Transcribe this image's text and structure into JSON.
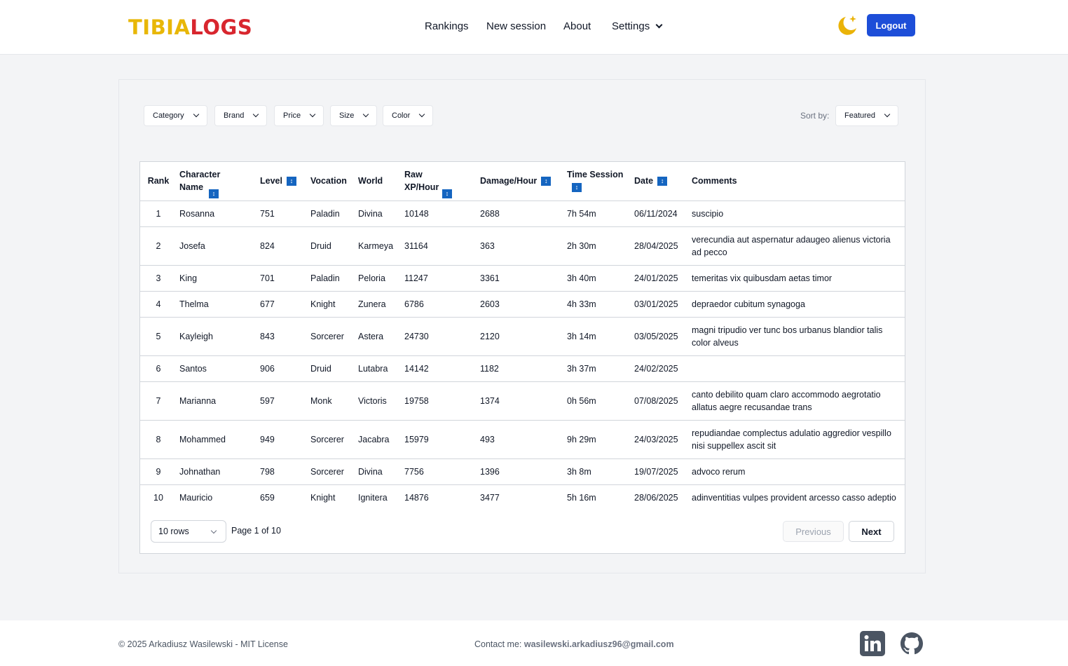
{
  "header": {
    "logo_part1": "TIBIA",
    "logo_part2": "LOGS",
    "nav": [
      "Rankings",
      "New session",
      "About",
      "Settings"
    ],
    "theme_icon": "moon-star-icon",
    "logout_label": "Logout"
  },
  "filters": [
    "Category",
    "Brand",
    "Price",
    "Size",
    "Color"
  ],
  "sort": {
    "label": "Sort by:",
    "value": "Featured"
  },
  "table": {
    "columns": [
      "Rank",
      "Character Name",
      "Level",
      "Vocation",
      "World",
      "Raw XP/Hour",
      "Damage/Hour",
      "Time Session",
      "Date",
      "Comments"
    ],
    "rows": [
      {
        "rank": "1",
        "name": "Rosanna",
        "level": "751",
        "vocation": "Paladin",
        "world": "Divina",
        "xp": "10148",
        "damage": "2688",
        "time": "7h 54m",
        "date": "06/11/2024",
        "comments": "suscipio"
      },
      {
        "rank": "2",
        "name": "Josefa",
        "level": "824",
        "vocation": "Druid",
        "world": "Karmeya",
        "xp": "31164",
        "damage": "363",
        "time": "2h 30m",
        "date": "28/04/2025",
        "comments": "verecundia aut aspernatur adaugeo alienus victoria ad pecco"
      },
      {
        "rank": "3",
        "name": "King",
        "level": "701",
        "vocation": "Paladin",
        "world": "Peloria",
        "xp": "11247",
        "damage": "3361",
        "time": "3h 40m",
        "date": "24/01/2025",
        "comments": "temeritas vix quibusdam aetas timor"
      },
      {
        "rank": "4",
        "name": "Thelma",
        "level": "677",
        "vocation": "Knight",
        "world": "Zunera",
        "xp": "6786",
        "damage": "2603",
        "time": "4h 33m",
        "date": "03/01/2025",
        "comments": "depraedor cubitum synagoga"
      },
      {
        "rank": "5",
        "name": "Kayleigh",
        "level": "843",
        "vocation": "Sorcerer",
        "world": "Astera",
        "xp": "24730",
        "damage": "2120",
        "time": "3h 14m",
        "date": "03/05/2025",
        "comments": "magni tripudio ver tunc bos urbanus blandior talis color alveus"
      },
      {
        "rank": "6",
        "name": "Santos",
        "level": "906",
        "vocation": "Druid",
        "world": "Lutabra",
        "xp": "14142",
        "damage": "1182",
        "time": "3h 37m",
        "date": "24/02/2025",
        "comments": ""
      },
      {
        "rank": "7",
        "name": "Marianna",
        "level": "597",
        "vocation": "Monk",
        "world": "Victoris",
        "xp": "19758",
        "damage": "1374",
        "time": "0h 56m",
        "date": "07/08/2025",
        "comments": "canto debilito quam claro accommodo aegrotatio allatus aegre recusandae trans"
      },
      {
        "rank": "8",
        "name": "Mohammed",
        "level": "949",
        "vocation": "Sorcerer",
        "world": "Jacabra",
        "xp": "15979",
        "damage": "493",
        "time": "9h 29m",
        "date": "24/03/2025",
        "comments": "repudiandae complectus adulatio aggredior vespillo nisi suppellex ascit sit"
      },
      {
        "rank": "9",
        "name": "Johnathan",
        "level": "798",
        "vocation": "Sorcerer",
        "world": "Divina",
        "xp": "7756",
        "damage": "1396",
        "time": "3h 8m",
        "date": "19/07/2025",
        "comments": "advoco rerum"
      },
      {
        "rank": "10",
        "name": "Mauricio",
        "level": "659",
        "vocation": "Knight",
        "world": "Ignitera",
        "xp": "14876",
        "damage": "3477",
        "time": "5h 16m",
        "date": "28/06/2025",
        "comments": "adinventitias vulpes provident arcesso casso adeptio"
      }
    ]
  },
  "pagination": {
    "rows_per_page": "10 rows",
    "page_info": "Page 1 of 10",
    "previous_label": "Previous",
    "next_label": "Next"
  },
  "footer": {
    "copyright": "© 2025 Arkadiusz Wasilewski - MIT License",
    "contact_label": "Contact me: ",
    "contact_email": "wasilewski.arkadiusz96@gmail.com",
    "icons": [
      "linkedin-icon",
      "github-icon"
    ]
  },
  "colors": {
    "primary": "#1d4ed8",
    "logo_yellow": "#e8b707",
    "logo_red": "#d8262e",
    "sort_icon": "#1565c0"
  }
}
